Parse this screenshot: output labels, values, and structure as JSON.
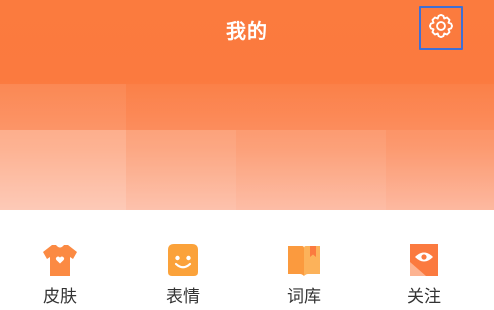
{
  "header": {
    "title": "我的"
  },
  "icons": {
    "settings": "gear-icon"
  },
  "menu": {
    "items": [
      {
        "label": "皮肤",
        "icon": "tshirt-icon"
      },
      {
        "label": "表情",
        "icon": "smiley-icon"
      },
      {
        "label": "词库",
        "icon": "book-icon"
      },
      {
        "label": "关注",
        "icon": "eye-bookmark-icon"
      }
    ]
  },
  "colors": {
    "accent": "#fb7a3f",
    "icon_orange": "#fb8a43",
    "highlight_border": "#3d6fd6"
  }
}
